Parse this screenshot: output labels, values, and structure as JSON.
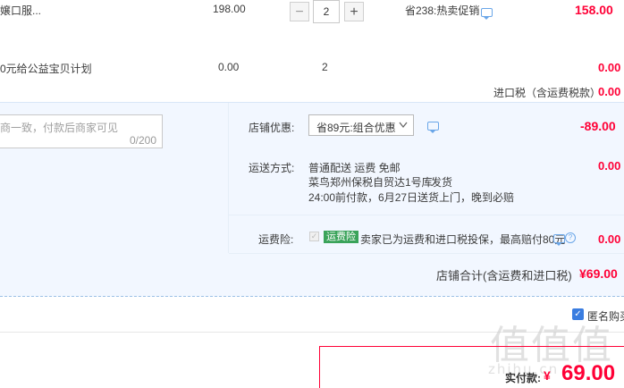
{
  "items": [
    {
      "title": "嬢口服...",
      "unit_price": "198.00",
      "qty_minus": "−",
      "quantity": "2",
      "qty_plus": "+",
      "promo": "省238:热卖促销",
      "subtotal": "158.00"
    },
    {
      "title": "0元给公益宝贝计划",
      "unit_price": "0.00",
      "quantity": "2",
      "subtotal": "0.00"
    }
  ],
  "import_tax": {
    "label": "进口税（含运费税款）",
    "value": "0.00"
  },
  "message": {
    "placeholder": "商一致，付款后商家可见",
    "counter": "0/200"
  },
  "shop_discount": {
    "label": "店铺优惠:",
    "selected": "省89元:组合优惠",
    "value": "-89.00"
  },
  "shipping": {
    "label": "运送方式:",
    "line1": "普通配送 运费 免邮",
    "line2": "菜鸟郑州保税自贸达1号库",
    "line2_suffix": "发货",
    "line3": "24:00前付款，6月27日送货上门，晚到必赔",
    "value": "0.00"
  },
  "insurance": {
    "label": "运费险:",
    "badge": "运费险",
    "text": "卖家已为运费和进口税投保，最高赔付80元",
    "value": "0.00"
  },
  "shop_total": {
    "label": "店铺合计(含运费和进口税)",
    "value": "¥69.00"
  },
  "anonymous": {
    "label": "匿名购买"
  },
  "payment": {
    "label": "实付款:",
    "currency": "¥",
    "value": "69.00"
  },
  "watermark": {
    "glyphs": "值值值",
    "domain": "zhihu.cn"
  },
  "colors": {
    "accent_red": "#ff0036",
    "panel_blue": "#f2f7ff",
    "badge_green": "#3aa35a",
    "checkbox_blue": "#3a7de0"
  }
}
